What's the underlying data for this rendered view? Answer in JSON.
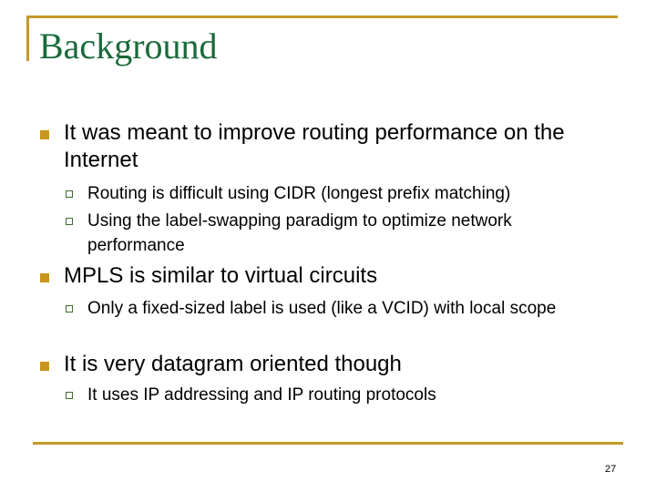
{
  "slide": {
    "title": "Background",
    "page_number": "27",
    "colors": {
      "accent": "#c49a2a",
      "title": "#1a6a3a",
      "bullet": "#c8961c",
      "sub_bullet_border": "#3e6b2f"
    },
    "bullets": [
      {
        "text": "It was meant to improve routing performance on the Internet",
        "sub": [
          "Routing is difficult using CIDR (longest prefix matching)",
          "Using the label-swapping paradigm to optimize network performance"
        ]
      },
      {
        "text": "MPLS is similar to virtual circuits",
        "sub": [
          "Only a fixed-sized label is used (like a VCID) with local scope"
        ]
      },
      {
        "text": "It is very datagram oriented though",
        "sub": [
          "It uses IP addressing and IP routing protocols"
        ]
      }
    ]
  }
}
